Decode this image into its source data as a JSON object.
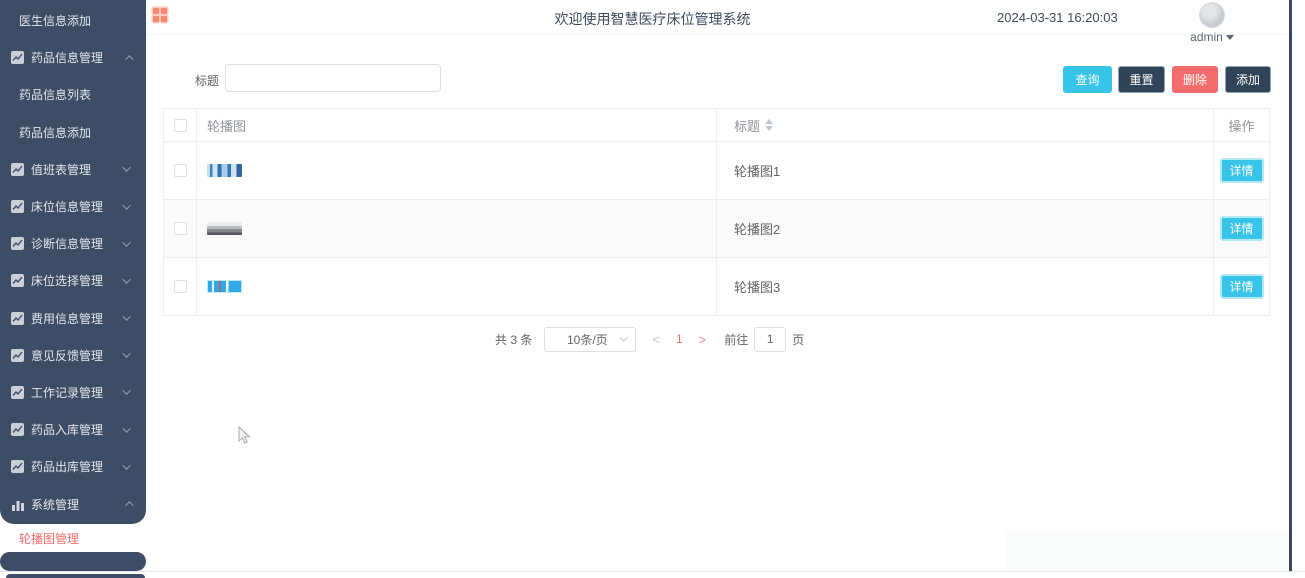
{
  "app": {
    "welcome": "欢迎使用智慧医疗床位管理系统",
    "timestamp": "2024-03-31 16:20:03",
    "user": "admin"
  },
  "sidebar": {
    "items": [
      {
        "label": "医生信息添加",
        "type": "sub"
      },
      {
        "label": "药品信息管理",
        "type": "parent",
        "state": "expanded",
        "icon": "line-chart-icon"
      },
      {
        "label": "药品信息列表",
        "type": "sub"
      },
      {
        "label": "药品信息添加",
        "type": "sub"
      },
      {
        "label": "值班表管理",
        "type": "parent",
        "state": "collapsed",
        "icon": "line-chart-icon"
      },
      {
        "label": "床位信息管理",
        "type": "parent",
        "state": "collapsed",
        "icon": "line-chart-icon"
      },
      {
        "label": "诊断信息管理",
        "type": "parent",
        "state": "collapsed",
        "icon": "line-chart-icon"
      },
      {
        "label": "床位选择管理",
        "type": "parent",
        "state": "collapsed",
        "icon": "line-chart-icon"
      },
      {
        "label": "费用信息管理",
        "type": "parent",
        "state": "collapsed",
        "icon": "line-chart-icon"
      },
      {
        "label": "意见反馈管理",
        "type": "parent",
        "state": "collapsed",
        "icon": "line-chart-icon"
      },
      {
        "label": "工作记录管理",
        "type": "parent",
        "state": "collapsed",
        "icon": "line-chart-icon"
      },
      {
        "label": "药品入库管理",
        "type": "parent",
        "state": "collapsed",
        "icon": "line-chart-icon"
      },
      {
        "label": "药品出库管理",
        "type": "parent",
        "state": "collapsed",
        "icon": "line-chart-icon"
      },
      {
        "label": "系统管理",
        "type": "parent",
        "state": "expanded",
        "icon": "bar-chart-icon"
      },
      {
        "label": "轮播图管理",
        "type": "sub",
        "active": true
      }
    ]
  },
  "filter": {
    "label": "标题",
    "value": "",
    "buttons": {
      "query": "查询",
      "reset": "重置",
      "delete": "删除",
      "add": "添加"
    }
  },
  "table": {
    "headers": {
      "image": "轮播图",
      "title": "标题",
      "action": "操作"
    },
    "rows": [
      {
        "title": "轮播图1",
        "action": "详情",
        "image_desc": "light blue banner thumbnail"
      },
      {
        "title": "轮播图2",
        "action": "详情",
        "image_desc": "gray landscape thumbnail"
      },
      {
        "title": "轮播图3",
        "action": "详情",
        "image_desc": "bright azure banner thumbnail"
      }
    ]
  },
  "pagination": {
    "total": "共 3 条",
    "page_size": "10条/页",
    "prev": "<",
    "current": "1",
    "next": ">",
    "goto_label": "前往",
    "goto_value": "1",
    "unit": "页"
  },
  "colors": {
    "sidebar_bg": "#3d4d66",
    "accent_cyan": "#38c3e8",
    "danger_red": "#f56c6c",
    "grid_icon_salmon": "#fa8970",
    "active_menu_text": "#f56c6c"
  }
}
